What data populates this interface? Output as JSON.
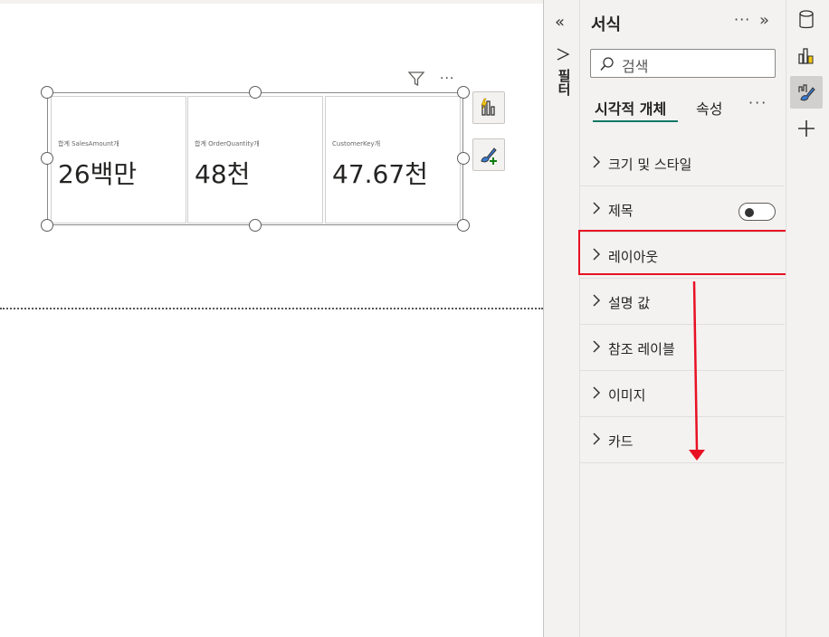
{
  "canvas": {
    "cards": [
      {
        "label": "합계 SalesAmount개",
        "value": "26백만"
      },
      {
        "label": "합계 OrderQuantity개",
        "value": "48천"
      },
      {
        "label": "CustomerKey개",
        "value": "47.67천"
      }
    ],
    "visual_header": {
      "more": "···"
    }
  },
  "filter_pane": {
    "label": "필터",
    "collapse_glyph": "«"
  },
  "format_pane": {
    "title": "서식",
    "more": "···",
    "expand_glyph": "»",
    "search_placeholder": "검색",
    "tabs": [
      {
        "label": "시각적 개체",
        "active": true
      },
      {
        "label": "속성",
        "active": false
      }
    ],
    "tabs_more": "···",
    "sections": [
      {
        "label": "크기 및 스타일"
      },
      {
        "label": "제목",
        "toggle": "off"
      },
      {
        "label": "레이아웃",
        "highlighted": true
      },
      {
        "label": "설명 값"
      },
      {
        "label": "참조 레이블"
      },
      {
        "label": "이미지"
      },
      {
        "label": "카드"
      }
    ]
  },
  "annotation": {
    "highlight_color": "#e81123",
    "arrow_color": "#e81123"
  },
  "colors": {
    "accent": "#117865",
    "pane_bg": "#f3f2f1"
  }
}
